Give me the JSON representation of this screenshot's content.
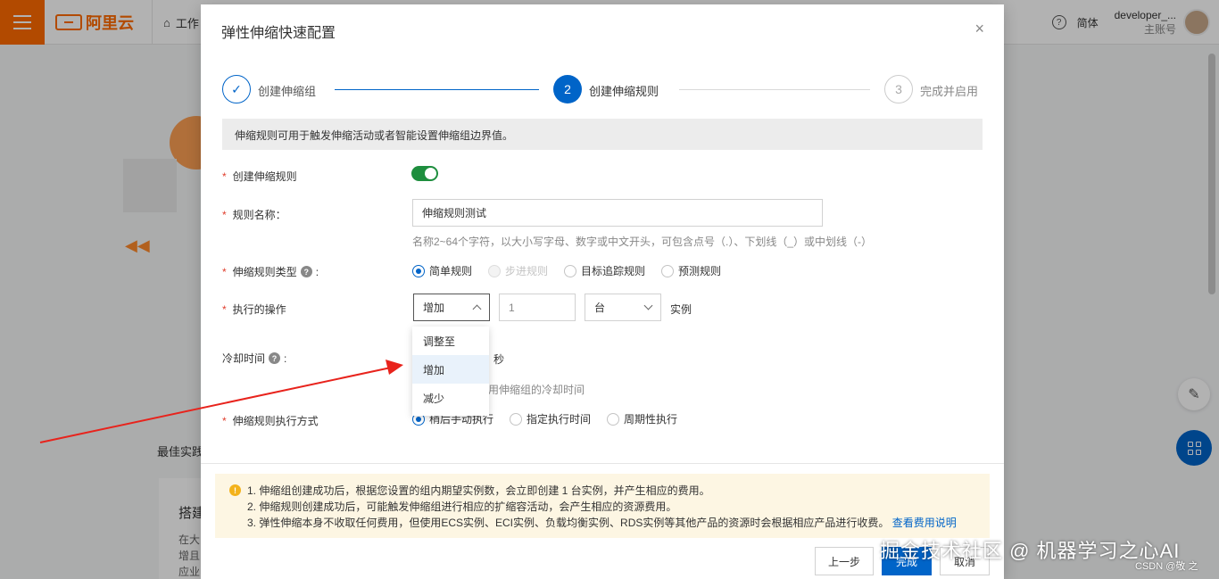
{
  "topbar": {
    "logo_text": "阿里云",
    "workspace_label": "工作",
    "lang": "简体",
    "user_name": "developer_...",
    "user_role": "主账号"
  },
  "background": {
    "best_practice": "最佳实践",
    "card_title": "搭建",
    "card_desc_lines": [
      "在大",
      "增且",
      "应业"
    ]
  },
  "dialog": {
    "title": "弹性伸缩快速配置",
    "close": "×",
    "steps": [
      {
        "number": "✓",
        "label": "创建伸缩组",
        "state": "done"
      },
      {
        "number": "2",
        "label": "创建伸缩规则",
        "state": "active"
      },
      {
        "number": "3",
        "label": "完成并启用",
        "state": "pending"
      }
    ],
    "info": "伸缩规则可用于触发伸缩活动或者智能设置伸缩组边界值。",
    "form": {
      "create_rule_label": "创建伸缩规则",
      "rule_name_label": "规则名称：",
      "rule_name_value": "伸缩规则测试",
      "rule_name_hint": "名称2~64个字符，以大小写字母、数字或中文开头，可包含点号（.）、下划线（_）或中划线（-）",
      "rule_type_label": "伸缩规则类型",
      "rule_type_colon": ":",
      "rule_type_options": [
        {
          "label": "简单规则",
          "checked": true,
          "disabled": false
        },
        {
          "label": "步进规则",
          "checked": false,
          "disabled": true
        },
        {
          "label": "目标追踪规则",
          "checked": false,
          "disabled": false
        },
        {
          "label": "预测规则",
          "checked": false,
          "disabled": false
        }
      ],
      "operation_label": "执行的操作",
      "operation_value": "增加",
      "operation_count": "1",
      "operation_unit": "台",
      "operation_suffix": "实例",
      "operation_menu": [
        {
          "label": "调整至",
          "active": false
        },
        {
          "label": "增加",
          "active": true
        },
        {
          "label": "减少",
          "active": false
        }
      ],
      "cooldown_label": "冷却时间",
      "cooldown_colon": ":",
      "cooldown_unit": "秒",
      "cooldown_hint": "用伸缩组的冷却时间",
      "exec_mode_label": "伸缩规则执行方式",
      "exec_mode_options": [
        {
          "label": "稍后手动执行",
          "checked": true
        },
        {
          "label": "指定执行时间",
          "checked": false
        },
        {
          "label": "周期性执行",
          "checked": false
        }
      ]
    },
    "notice": {
      "line1": "1. 伸缩组创建成功后，根据您设置的组内期望实例数，会立即创建 1 台实例，并产生相应的费用。",
      "line2": "2. 伸缩规则创建成功后，可能触发伸缩组进行相应的扩缩容活动，会产生相应的资源费用。",
      "line3": "3. 弹性伸缩本身不收取任何费用，但使用ECS实例、ECI实例、负载均衡实例、RDS实例等其他产品的资源时会根据相应产品进行收费。",
      "link": "查看费用说明"
    },
    "buttons": {
      "prev": "上一步",
      "finish": "完成",
      "cancel": "取消"
    }
  },
  "watermark": "掘金技术社区 @ 机器学习之心AI",
  "csdn": "CSDN @敬 之",
  "colors": {
    "brand": "#ff6a00",
    "primary": "#0064c8",
    "toggle_on": "#1e8e3e",
    "annotation_arrow": "#e8231c",
    "notice_bg": "#fdf6e3"
  }
}
